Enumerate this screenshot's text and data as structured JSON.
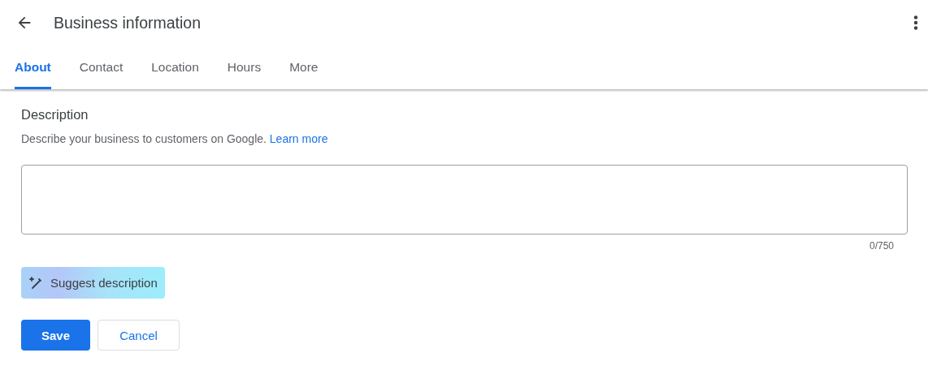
{
  "header": {
    "title": "Business information"
  },
  "tabs": [
    {
      "label": "About",
      "selected": true
    },
    {
      "label": "Contact",
      "selected": false
    },
    {
      "label": "Location",
      "selected": false
    },
    {
      "label": "Hours",
      "selected": false
    },
    {
      "label": "More",
      "selected": false
    }
  ],
  "description": {
    "heading": "Description",
    "hint": "Describe your business to customers on Google.",
    "link": "Learn more",
    "counter": "0/750"
  },
  "suggest_button": "Suggest description",
  "buttons": [
    {
      "label": "Save",
      "kind": "primary"
    },
    {
      "label": "Cancel",
      "kind": "secondary"
    }
  ]
}
